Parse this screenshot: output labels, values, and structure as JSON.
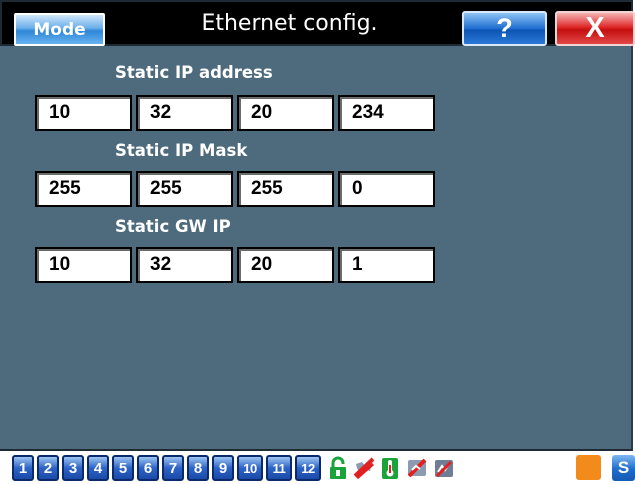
{
  "titlebar": {
    "mode_label": "Mode",
    "title": "Ethernet config.",
    "help_label": "?",
    "close_label": "X"
  },
  "sections": {
    "ip": {
      "label": "Static IP address",
      "octets": [
        "10",
        "32",
        "20",
        "234"
      ]
    },
    "mask": {
      "label": "Static IP Mask",
      "octets": [
        "255",
        "255",
        "255",
        "0"
      ]
    },
    "gw": {
      "label": "Static GW IP",
      "octets": [
        "10",
        "32",
        "20",
        "1"
      ]
    }
  },
  "toolbar": {
    "numbers": [
      "1",
      "2",
      "3",
      "4",
      "5",
      "6",
      "7",
      "8",
      "9",
      "10",
      "11",
      "12"
    ],
    "icons": [
      "unlock-icon",
      "no-fan-icon",
      "thermometer-icon",
      "no-heat-icon",
      "no-alarm-icon",
      "orange-status-icon"
    ],
    "s_label": "S"
  },
  "colors": {
    "background": "#4e6b7e",
    "titlebar": "#000000",
    "accent_blue": "#2f86d8",
    "close_red": "#d61616"
  }
}
